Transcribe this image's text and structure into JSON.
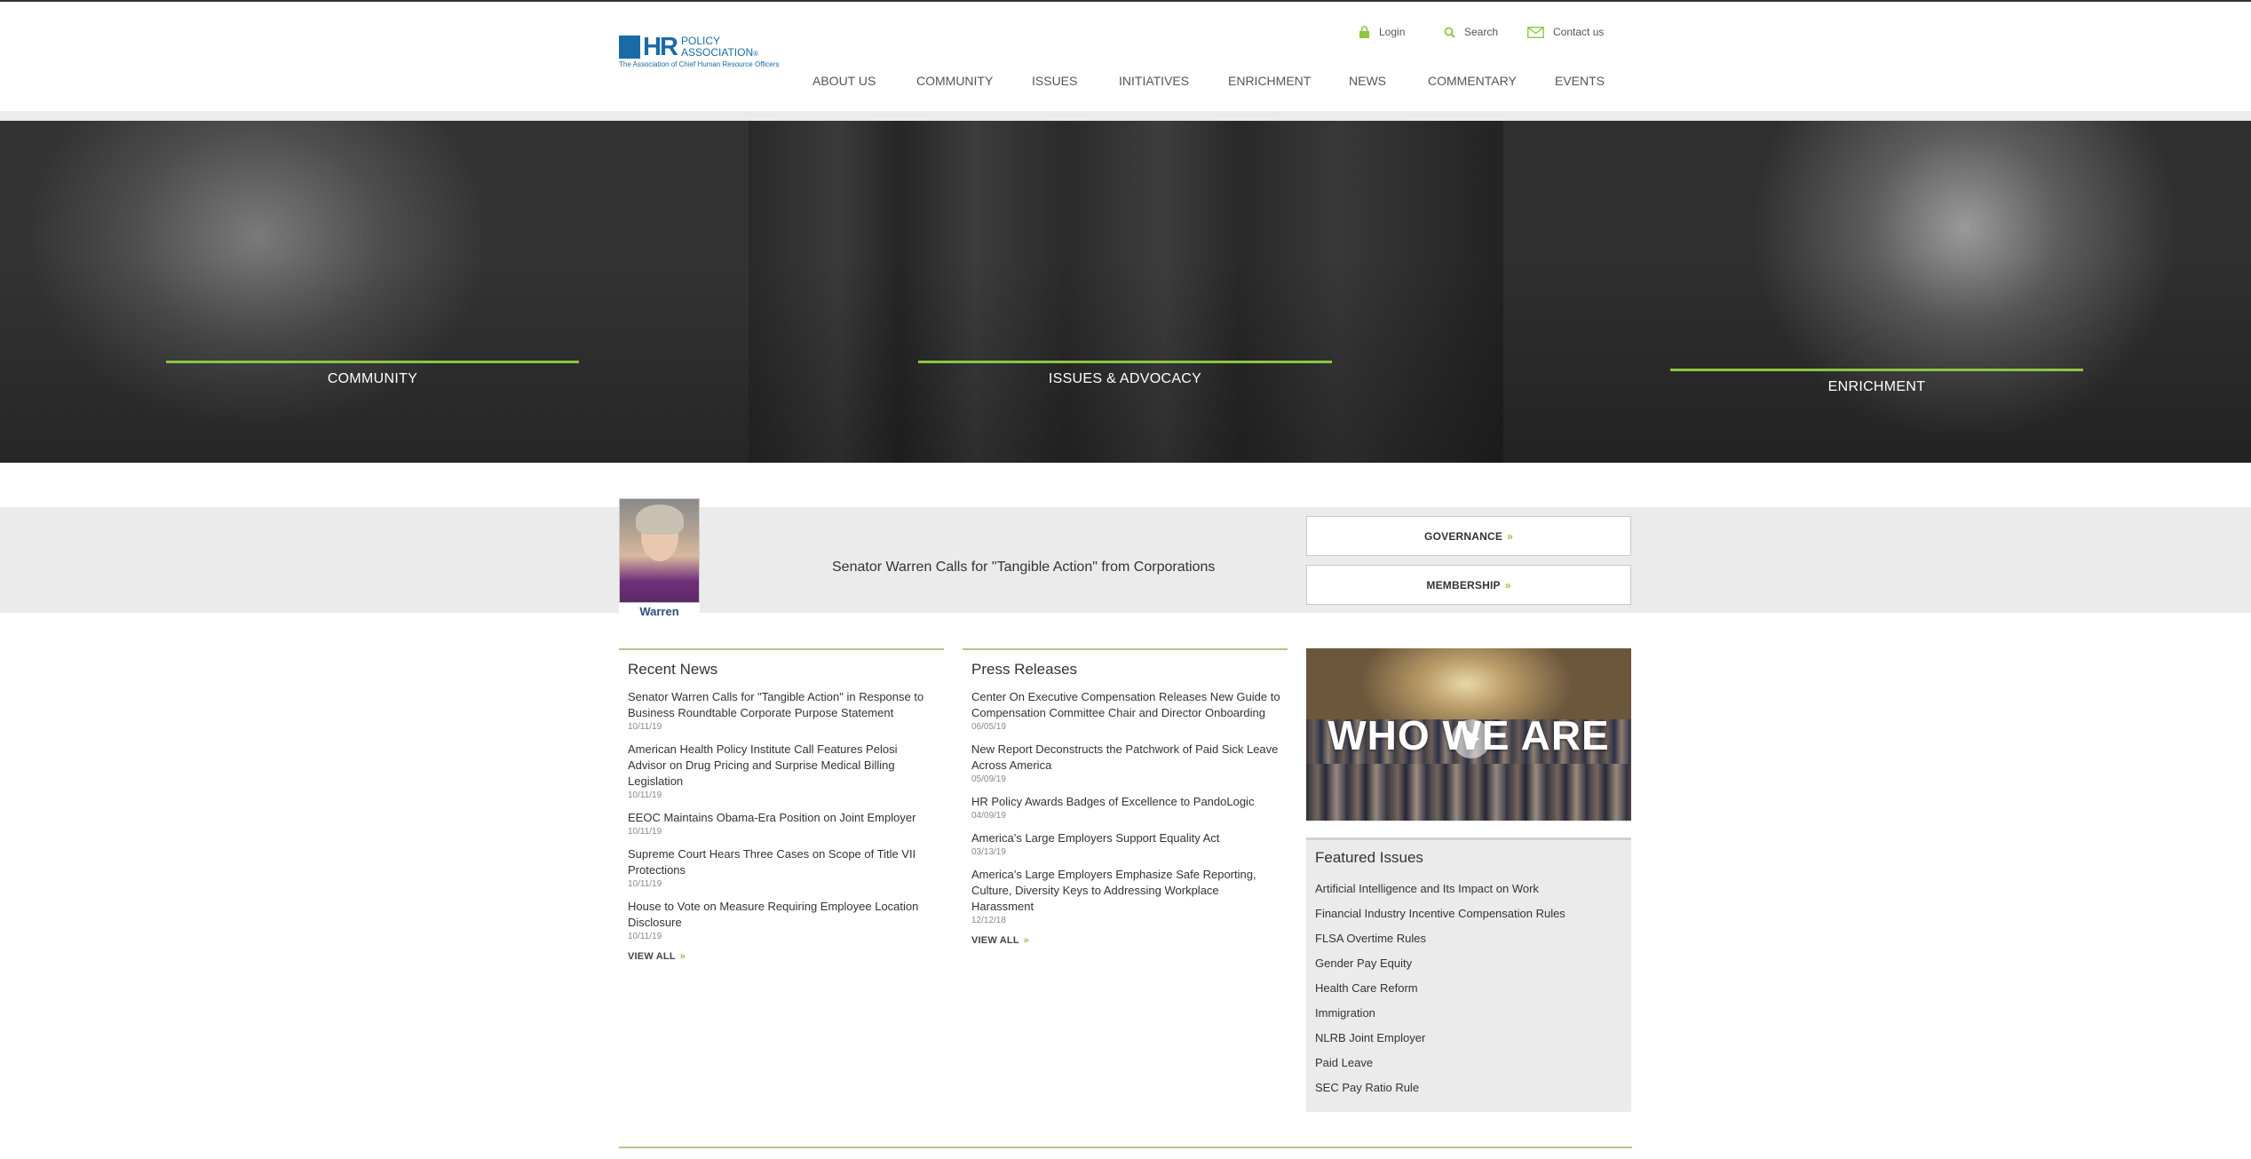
{
  "logo": {
    "mark": "HR",
    "line1": "POLICY",
    "line2": "ASSOCIATION",
    "reg": "®",
    "tagline": "The Association of Chief Human Resource Officers"
  },
  "utility": {
    "login": "Login",
    "search": "Search",
    "contact": "Contact us"
  },
  "nav": [
    "ABOUT US",
    "COMMUNITY",
    "ISSUES",
    "INITIATIVES",
    "ENRICHMENT",
    "NEWS",
    "COMMENTARY",
    "EVENTS"
  ],
  "hero": {
    "panels": [
      "COMMUNITY",
      "ISSUES & ADVOCACY",
      "ENRICHMENT"
    ]
  },
  "feature": {
    "photo_caption": "Warren",
    "headline": "Senator Warren Calls for \"Tangible Action\" from Corporations",
    "governance": "GOVERNANCE",
    "membership": "MEMBERSHIP",
    "chevron": "»"
  },
  "recent_news": {
    "title": "Recent News",
    "items": [
      {
        "title": "Senator Warren Calls for \"Tangible Action\" in Response to Business Roundtable Corporate Purpose Statement",
        "date": "10/11/19"
      },
      {
        "title": "American Health Policy Institute Call Features Pelosi Advisor on Drug Pricing and Surprise Medical Billing Legislation",
        "date": "10/11/19"
      },
      {
        "title": "EEOC Maintains Obama-Era Position on Joint Employer",
        "date": "10/11/19"
      },
      {
        "title": "Supreme Court Hears Three Cases on Scope of Title VII Protections",
        "date": "10/11/19"
      },
      {
        "title": "House to Vote on Measure Requiring Employee Location Disclosure",
        "date": "10/11/19"
      }
    ],
    "view_all": "VIEW ALL"
  },
  "press_releases": {
    "title": "Press Releases",
    "items": [
      {
        "title": "Center On Executive Compensation Releases New Guide to Compensation Committee Chair and Director Onboarding",
        "date": "06/05/19"
      },
      {
        "title": "New Report Deconstructs the Patchwork of Paid Sick Leave Across America",
        "date": "05/09/19"
      },
      {
        "title": "HR Policy Awards Badges of Excellence to PandoLogic",
        "date": "04/09/19"
      },
      {
        "title": "America’s Large Employers Support Equality Act",
        "date": "03/13/19"
      },
      {
        "title": "America’s Large Employers Emphasize Safe Reporting, Culture, Diversity Keys to Addressing Workplace Harassment",
        "date": "12/12/18"
      }
    ],
    "view_all": "VIEW ALL"
  },
  "video": {
    "title": "WHO WE ARE"
  },
  "featured_issues": {
    "title": "Featured Issues",
    "items": [
      "Artificial Intelligence and Its Impact on Work",
      "Financial Industry Incentive Compensation Rules",
      "FLSA Overtime Rules",
      "Gender Pay Equity",
      "Health Care Reform",
      "Immigration",
      "NLRB Joint Employer",
      "Paid Leave",
      "SEC Pay Ratio Rule"
    ]
  },
  "colors": {
    "brand_blue": "#1a6aa8",
    "accent_green": "#8dc63f",
    "band_gray": "#ebebeb"
  }
}
